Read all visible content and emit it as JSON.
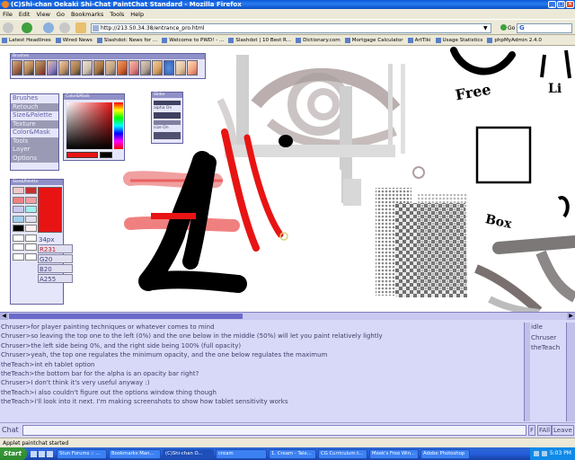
{
  "window": {
    "title": "(C)Shi-chan Oekaki Shi-Chat PaintChat Standard - Mozilla Firefox",
    "controls": [
      "_",
      "□",
      "×"
    ]
  },
  "menu": [
    "File",
    "Edit",
    "View",
    "Go",
    "Bookmarks",
    "Tools",
    "Help"
  ],
  "nav": {
    "url": "http://213.50.34.38/entrance_pro.html",
    "go_label": "Go",
    "search_value": "G"
  },
  "bookmarks": [
    "Latest Headlines",
    "Wired News",
    "Slashdot: News for ...",
    "Welcome to PWD! - ...",
    "Slashdot | 10 Best R...",
    "Dictionary.com",
    "Mortgage Calculator",
    "ArtTiki",
    "Usage Statistics",
    "phpMyAdmin 2.4.0"
  ],
  "panels": {
    "brushes_title": "Brushes",
    "color_mask_title": "Color&Mask",
    "sliders_title": "Slider",
    "alpha_on": "alpha On",
    "size_on": "size On",
    "size_palette_title": "Size&Palette",
    "tool_menu": [
      {
        "label": "Brushes",
        "active": false
      },
      {
        "label": "Retouch",
        "active": true
      },
      {
        "label": "Size&Palette",
        "active": false
      },
      {
        "label": "Texture",
        "active": true
      },
      {
        "label": "Color&Mask",
        "active": false
      },
      {
        "label": "Tools",
        "active": true
      },
      {
        "label": "Layer",
        "active": true
      },
      {
        "label": "Options",
        "active": true
      }
    ],
    "size_px": "34px",
    "rgba": [
      "R231",
      "G20",
      "B20",
      "A255"
    ],
    "current_color": "#e81414",
    "palette": [
      "#f0c8c8",
      "#c83030",
      "#f08080",
      "#f0a0a0",
      "#c8c8f0",
      "#a0f0f0",
      "#a0d0f0",
      "#e0e0f0",
      "#000000",
      "#fff0f0",
      "#ffffff",
      "#ffffff",
      "#ffffff",
      "#ffffff",
      "#ffffff",
      "#ffffff"
    ]
  },
  "canvas_texts": {
    "free": "Free",
    "box": "Box",
    "li": "Li"
  },
  "chat": {
    "messages": [
      "Chruser>for player painting techniques or whatever comes to mind",
      "Chruser>so leaving the top one to the left (0%) and the one below in the middle (50%) will let you paint relatively lightly",
      "Chruser>the left side being 0%, and the right side being 100% (full opacity)",
      "Chruser>yeah, the top one regulates the minimum opacity, and the one below regulates the maximum",
      "theTeach>int eh tablet option",
      "theTeach>the bottom bar for the alpha is an opacity bar right?",
      "Chruser>I don't think it's very useful anyway :)",
      "theTeach>i also couldn't figure out the options window thing though",
      "theTeach>i'll look into it next. I'm making screenshots to show how tablet sensitivity works"
    ],
    "users": [
      "idle",
      "Chruser",
      "theTeach"
    ],
    "chat_label": "Chat",
    "buttons": [
      "F",
      "FAll",
      "Leave"
    ]
  },
  "status": "Applet paintchat started",
  "taskbar": {
    "start": "Start",
    "items": [
      "Stun Forums :: ...",
      "Bookmarks Man...",
      "(C)Shi-chan O...",
      "cream",
      "1. Cream - Tale...",
      "CG Curriculum.t...",
      "Meek's Free Win...",
      "Adobe Photoshop"
    ],
    "active_index": 2,
    "clock": "5:03 PM"
  },
  "colors": {
    "panel_bg": "#e6e6fa",
    "chat_bg": "#d8d8f8",
    "accent": "#6060a8",
    "xp_blue": "#245edb"
  }
}
